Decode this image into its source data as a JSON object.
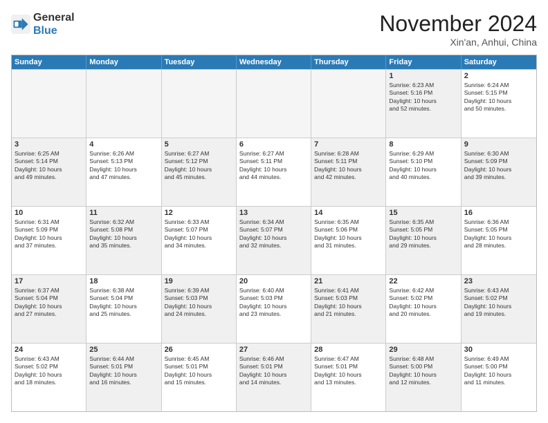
{
  "header": {
    "logo_line1": "General",
    "logo_line2": "Blue",
    "month": "November 2024",
    "location": "Xin'an, Anhui, China"
  },
  "weekdays": [
    "Sunday",
    "Monday",
    "Tuesday",
    "Wednesday",
    "Thursday",
    "Friday",
    "Saturday"
  ],
  "rows": [
    [
      {
        "day": "",
        "text": "",
        "empty": true
      },
      {
        "day": "",
        "text": "",
        "empty": true
      },
      {
        "day": "",
        "text": "",
        "empty": true
      },
      {
        "day": "",
        "text": "",
        "empty": true
      },
      {
        "day": "",
        "text": "",
        "empty": true
      },
      {
        "day": "1",
        "text": "Sunrise: 6:23 AM\nSunset: 5:16 PM\nDaylight: 10 hours\nand 52 minutes."
      },
      {
        "day": "2",
        "text": "Sunrise: 6:24 AM\nSunset: 5:15 PM\nDaylight: 10 hours\nand 50 minutes."
      }
    ],
    [
      {
        "day": "3",
        "text": "Sunrise: 6:25 AM\nSunset: 5:14 PM\nDaylight: 10 hours\nand 49 minutes."
      },
      {
        "day": "4",
        "text": "Sunrise: 6:26 AM\nSunset: 5:13 PM\nDaylight: 10 hours\nand 47 minutes."
      },
      {
        "day": "5",
        "text": "Sunrise: 6:27 AM\nSunset: 5:12 PM\nDaylight: 10 hours\nand 45 minutes."
      },
      {
        "day": "6",
        "text": "Sunrise: 6:27 AM\nSunset: 5:11 PM\nDaylight: 10 hours\nand 44 minutes."
      },
      {
        "day": "7",
        "text": "Sunrise: 6:28 AM\nSunset: 5:11 PM\nDaylight: 10 hours\nand 42 minutes."
      },
      {
        "day": "8",
        "text": "Sunrise: 6:29 AM\nSunset: 5:10 PM\nDaylight: 10 hours\nand 40 minutes."
      },
      {
        "day": "9",
        "text": "Sunrise: 6:30 AM\nSunset: 5:09 PM\nDaylight: 10 hours\nand 39 minutes."
      }
    ],
    [
      {
        "day": "10",
        "text": "Sunrise: 6:31 AM\nSunset: 5:09 PM\nDaylight: 10 hours\nand 37 minutes."
      },
      {
        "day": "11",
        "text": "Sunrise: 6:32 AM\nSunset: 5:08 PM\nDaylight: 10 hours\nand 35 minutes."
      },
      {
        "day": "12",
        "text": "Sunrise: 6:33 AM\nSunset: 5:07 PM\nDaylight: 10 hours\nand 34 minutes."
      },
      {
        "day": "13",
        "text": "Sunrise: 6:34 AM\nSunset: 5:07 PM\nDaylight: 10 hours\nand 32 minutes."
      },
      {
        "day": "14",
        "text": "Sunrise: 6:35 AM\nSunset: 5:06 PM\nDaylight: 10 hours\nand 31 minutes."
      },
      {
        "day": "15",
        "text": "Sunrise: 6:35 AM\nSunset: 5:05 PM\nDaylight: 10 hours\nand 29 minutes."
      },
      {
        "day": "16",
        "text": "Sunrise: 6:36 AM\nSunset: 5:05 PM\nDaylight: 10 hours\nand 28 minutes."
      }
    ],
    [
      {
        "day": "17",
        "text": "Sunrise: 6:37 AM\nSunset: 5:04 PM\nDaylight: 10 hours\nand 27 minutes."
      },
      {
        "day": "18",
        "text": "Sunrise: 6:38 AM\nSunset: 5:04 PM\nDaylight: 10 hours\nand 25 minutes."
      },
      {
        "day": "19",
        "text": "Sunrise: 6:39 AM\nSunset: 5:03 PM\nDaylight: 10 hours\nand 24 minutes."
      },
      {
        "day": "20",
        "text": "Sunrise: 6:40 AM\nSunset: 5:03 PM\nDaylight: 10 hours\nand 23 minutes."
      },
      {
        "day": "21",
        "text": "Sunrise: 6:41 AM\nSunset: 5:03 PM\nDaylight: 10 hours\nand 21 minutes."
      },
      {
        "day": "22",
        "text": "Sunrise: 6:42 AM\nSunset: 5:02 PM\nDaylight: 10 hours\nand 20 minutes."
      },
      {
        "day": "23",
        "text": "Sunrise: 6:43 AM\nSunset: 5:02 PM\nDaylight: 10 hours\nand 19 minutes."
      }
    ],
    [
      {
        "day": "24",
        "text": "Sunrise: 6:43 AM\nSunset: 5:02 PM\nDaylight: 10 hours\nand 18 minutes."
      },
      {
        "day": "25",
        "text": "Sunrise: 6:44 AM\nSunset: 5:01 PM\nDaylight: 10 hours\nand 16 minutes."
      },
      {
        "day": "26",
        "text": "Sunrise: 6:45 AM\nSunset: 5:01 PM\nDaylight: 10 hours\nand 15 minutes."
      },
      {
        "day": "27",
        "text": "Sunrise: 6:46 AM\nSunset: 5:01 PM\nDaylight: 10 hours\nand 14 minutes."
      },
      {
        "day": "28",
        "text": "Sunrise: 6:47 AM\nSunset: 5:01 PM\nDaylight: 10 hours\nand 13 minutes."
      },
      {
        "day": "29",
        "text": "Sunrise: 6:48 AM\nSunset: 5:00 PM\nDaylight: 10 hours\nand 12 minutes."
      },
      {
        "day": "30",
        "text": "Sunrise: 6:49 AM\nSunset: 5:00 PM\nDaylight: 10 hours\nand 11 minutes."
      }
    ]
  ]
}
